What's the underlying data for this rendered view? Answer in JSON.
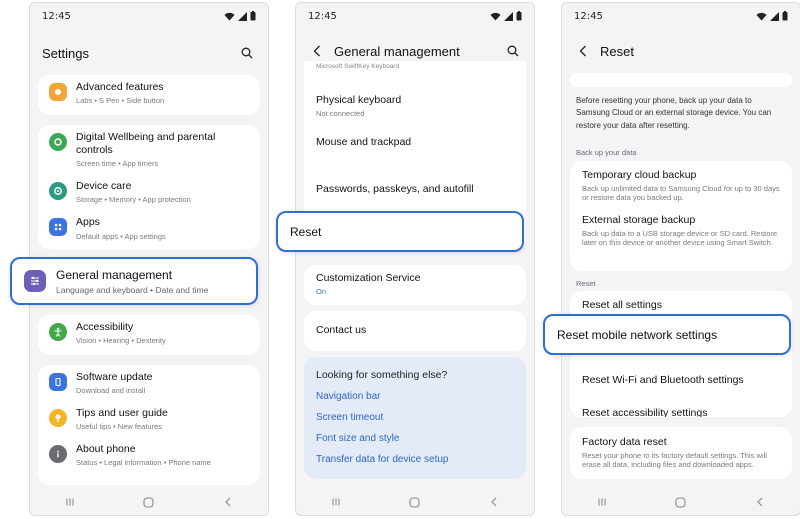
{
  "status_bar": {
    "time": "12:45"
  },
  "screen1": {
    "title": "Settings",
    "items": [
      {
        "title": "Advanced features",
        "subtitle": "Labs  •  S Pen  •  Side button",
        "color": "#f4a53a",
        "icon": "star-icon"
      },
      {
        "title": "Digital Wellbeing and parental controls",
        "subtitle": "Screen time  •  App timers",
        "color": "#3da858",
        "icon": "wellbeing-icon"
      },
      {
        "title": "Device care",
        "subtitle": "Storage  •  Memory  •  App protection",
        "color": "#2f9a84",
        "icon": "device-care-icon"
      },
      {
        "title": "Apps",
        "subtitle": "Default apps  •  App settings",
        "color": "#3b73e0",
        "icon": "apps-icon"
      },
      {
        "title": "Accessibility",
        "subtitle": "Vision  •  Hearing  •  Dexterity",
        "color": "#43a84a",
        "icon": "accessibility-icon"
      },
      {
        "title": "Software update",
        "subtitle": "Download and install",
        "color": "#3b73e0",
        "icon": "software-update-icon"
      },
      {
        "title": "Tips and user guide",
        "subtitle": "Useful tips  •  New features",
        "color": "#f2b527",
        "icon": "tips-icon"
      },
      {
        "title": "About phone",
        "subtitle": "Status  •  Legal information  •  Phone name",
        "color": "#6a6a70",
        "icon": "info-icon"
      }
    ],
    "highlight": {
      "title": "General management",
      "subtitle": "Language and keyboard  •  Date and time",
      "color": "#6c5fb8",
      "icon": "sliders-icon"
    }
  },
  "screen2": {
    "title": "General management",
    "cut_text": "Microsoft SwiftKey Keyboard",
    "items": [
      {
        "title": "Physical keyboard",
        "subtitle": "Not connected"
      },
      {
        "title": "Mouse and trackpad"
      },
      {
        "title": "Passwords, passkeys, and autofill"
      }
    ],
    "highlight": "Reset",
    "customization": {
      "title": "Customization Service",
      "subtitle": "On"
    },
    "contact": "Contact us",
    "looking": {
      "heading": "Looking for something else?",
      "links": [
        "Navigation bar",
        "Screen timeout",
        "Font size and style",
        "Transfer data for device setup"
      ]
    }
  },
  "screen3": {
    "title": "Reset",
    "description": "Before resetting your phone, back up your data to Samsung Cloud or an external storage device. You can restore your data after resetting.",
    "backup_label": "Back up your data",
    "backup_items": [
      {
        "title": "Temporary cloud backup",
        "subtitle": "Back up unlimited data to Samsung Cloud for up to 30 days or restore data you backed up."
      },
      {
        "title": "External storage backup",
        "subtitle": "Back up data to a USB storage device or SD card. Restore later on this device or another device using Smart Switch."
      }
    ],
    "reset_label": "Reset",
    "reset_items": [
      "Reset all settings",
      "Reset Wi-Fi and Bluetooth settings",
      "Reset accessibility settings"
    ],
    "highlight": "Reset mobile network settings",
    "factory": {
      "title": "Factory data reset",
      "subtitle": "Reset your phone to its factory default settings. This will erase all data, including files and downloaded apps."
    }
  },
  "colors": {
    "accent": "#2f6fd4",
    "link": "#2e67c3",
    "background": "#f4f4f7"
  }
}
